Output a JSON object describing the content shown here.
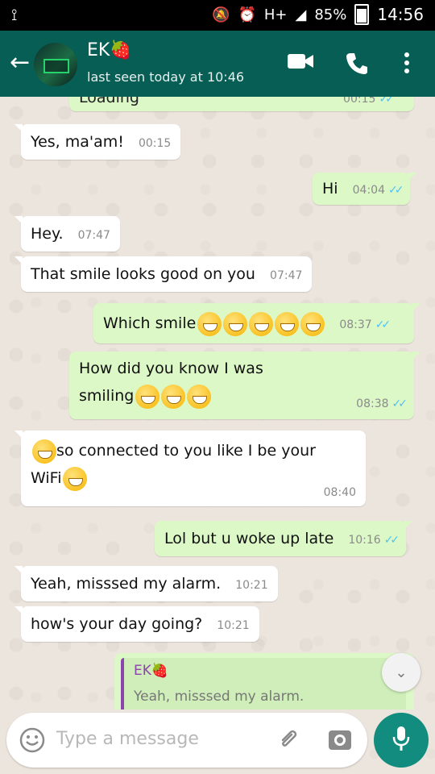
{
  "status_bar": {
    "battery": "85%",
    "time": "14:56",
    "network": "H+"
  },
  "header": {
    "contact_name": "EK🍓",
    "last_seen": "last seen today at 10:46"
  },
  "messages": [
    {
      "dir": "out",
      "text": "Loading",
      "time": "00:15",
      "ticks": "✓✓",
      "partial": true
    },
    {
      "dir": "in",
      "text": "Yes, ma'am!",
      "time": "00:15"
    },
    {
      "dir": "out",
      "text": "Hi",
      "time": "04:04",
      "ticks": "✓✓"
    },
    {
      "dir": "in",
      "text": "Hey.",
      "time": "07:47"
    },
    {
      "dir": "in",
      "text": "That smile looks good on you",
      "time": "07:47"
    },
    {
      "dir": "out",
      "text": "Which smile",
      "emoji_count": 5,
      "time": "08:37",
      "ticks": "✓✓"
    },
    {
      "dir": "out",
      "text_line1": "How did you know I was",
      "text_line2": "smiling",
      "emoji_count": 3,
      "time": "08:38",
      "ticks": "✓✓"
    },
    {
      "dir": "in",
      "text_line1": "so connected to you like I be your",
      "text_line2": "WiFi",
      "time": "08:40"
    },
    {
      "dir": "out",
      "text": "Lol but u woke up late",
      "time": "10:16",
      "ticks": "✓✓"
    },
    {
      "dir": "in",
      "text": "Yeah,  misssed my alarm.",
      "time": "10:21"
    },
    {
      "dir": "in",
      "text": "how's your day going?",
      "time": "10:21"
    }
  ],
  "reply_preview": {
    "name": "EK🍓",
    "text": "Yeah,  misssed my alarm."
  },
  "input": {
    "placeholder": "Type a message"
  },
  "colors": {
    "header": "#075e54",
    "outgoing_bubble": "#dcf8c6",
    "incoming_bubble": "#ffffff",
    "accent": "#128c7e",
    "read_ticks": "#4fc3f7"
  }
}
